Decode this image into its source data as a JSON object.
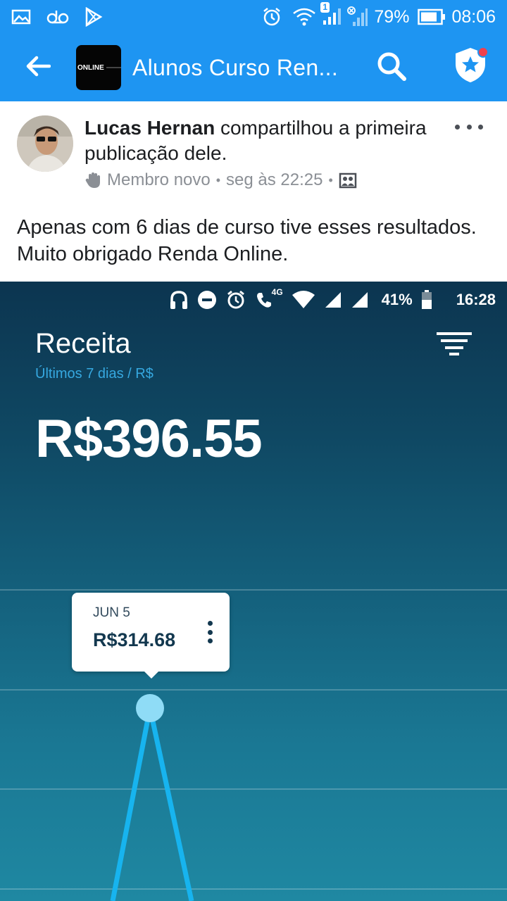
{
  "status_bar": {
    "battery_percent": "79%",
    "time": "08:06",
    "notification_badge": "1",
    "icons_left": [
      "image-icon",
      "voicemail-icon",
      "play-store-icon"
    ],
    "icons_right": [
      "alarm-icon",
      "wifi-icon",
      "signal-icon",
      "signal-off-icon",
      "battery-icon"
    ]
  },
  "app_bar": {
    "title": "Alunos Curso Ren...",
    "group_thumb_text": "ONLINE"
  },
  "post": {
    "author": "Lucas Hernan",
    "action": " compartilhou a primeira publicação dele.",
    "badge": "Membro novo",
    "time": "seg às 22:25",
    "body": "Apenas com 6 dias de curso tive esses resultados. Muito obrigado Renda Online."
  },
  "screenshot": {
    "status": {
      "network": "4G",
      "battery_percent": "41%",
      "time": "16:28"
    },
    "title": "Receita",
    "subtitle": "Últimos 7 dias / R$",
    "total": "R$396.55",
    "tooltip": {
      "date": "JUN 5",
      "value": "R$314.68"
    }
  },
  "colors": {
    "facebook_blue": "#1e95f2",
    "chart_line": "#17b4ef",
    "point": "#8fdcf6",
    "subtitle_blue": "#36a8e0"
  }
}
